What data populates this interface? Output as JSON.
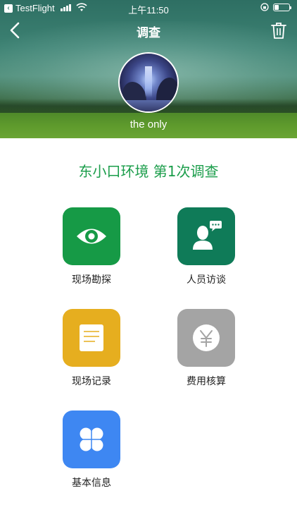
{
  "status_bar": {
    "back_app": "TestFlight",
    "time": "上午11:50"
  },
  "nav": {
    "title": "调查",
    "back_icon": "chevron-left-icon",
    "delete_icon": "trash-icon"
  },
  "profile": {
    "username": "the only"
  },
  "survey": {
    "title": "东小口环境 第1次调查"
  },
  "tiles": [
    {
      "label": "现场勘探",
      "icon": "eye-icon",
      "color": "#169a46"
    },
    {
      "label": "人员访谈",
      "icon": "person-chat-icon",
      "color": "#0f7b58"
    },
    {
      "label": "现场记录",
      "icon": "note-icon",
      "color": "#e6ae1f"
    },
    {
      "label": "费用核算",
      "icon": "yen-icon",
      "color": "#a4a4a4"
    },
    {
      "label": "基本信息",
      "icon": "clover-icon",
      "color": "#3e87f2"
    }
  ],
  "colors": {
    "accent_green": "#1a9d4a"
  }
}
